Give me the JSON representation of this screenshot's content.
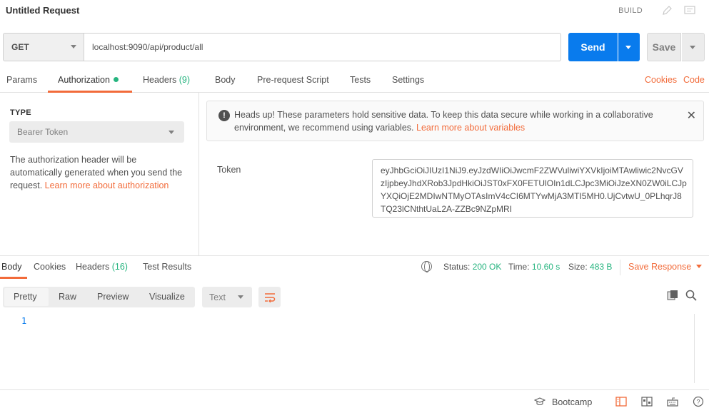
{
  "window": {
    "title": "Untitled Request",
    "build_label": "BUILD"
  },
  "request": {
    "method": "GET",
    "url": "localhost:9090/api/product/all",
    "send_label": "Send",
    "save_label": "Save"
  },
  "tabs": {
    "params": "Params",
    "authorization": "Authorization",
    "headers": "Headers",
    "headers_count": "(9)",
    "body": "Body",
    "prerequest": "Pre-request Script",
    "tests": "Tests",
    "settings": "Settings",
    "cookies": "Cookies",
    "code": "Code"
  },
  "auth": {
    "type_label": "TYPE",
    "type_value": "Bearer Token",
    "desc": "The authorization header will be automatically generated when you send the request.",
    "desc_link": "Learn more about authorization"
  },
  "alert": {
    "text": "Heads up! These parameters hold sensitive data. To keep this data secure while working in a collaborative environment, we recommend using variables.",
    "link": "Learn more about variables"
  },
  "token": {
    "label": "Token",
    "value": "eyJhbGciOiJIUzI1NiJ9.eyJzdWIiOiJwcmF2ZWVuliwiYXVkIjoiMTAwliwic2NvcGVzIjpbeyJhdXRob3JpdHkiOiJST0xFX0FETUlOIn1dLCJpc3MiOiJzeXN0ZW0iLCJpYXQiOjE2MDIwNTMyOTAsImV4cCI6MTYwMjA3MTI5MH0.UjCvtwU_0PLhqrJ8TQ23lCNthtUaL2A-ZZBc9NZpMRI"
  },
  "response": {
    "tabs": {
      "body": "Body",
      "cookies": "Cookies",
      "headers": "Headers",
      "headers_count": "(16)",
      "test_results": "Test Results"
    },
    "status_label": "Status:",
    "status_value": "200 OK",
    "time_label": "Time:",
    "time_value": "10.60 s",
    "size_label": "Size:",
    "size_value": "483 B",
    "save_response": "Save Response",
    "formats": {
      "pretty": "Pretty",
      "raw": "Raw",
      "preview": "Preview",
      "visualize": "Visualize"
    },
    "language": "Text",
    "line_number": "1"
  },
  "footer": {
    "bootcamp": "Bootcamp"
  },
  "colors": {
    "accent": "#f26b3a",
    "primary": "#097bed",
    "success": "#26b47f"
  }
}
